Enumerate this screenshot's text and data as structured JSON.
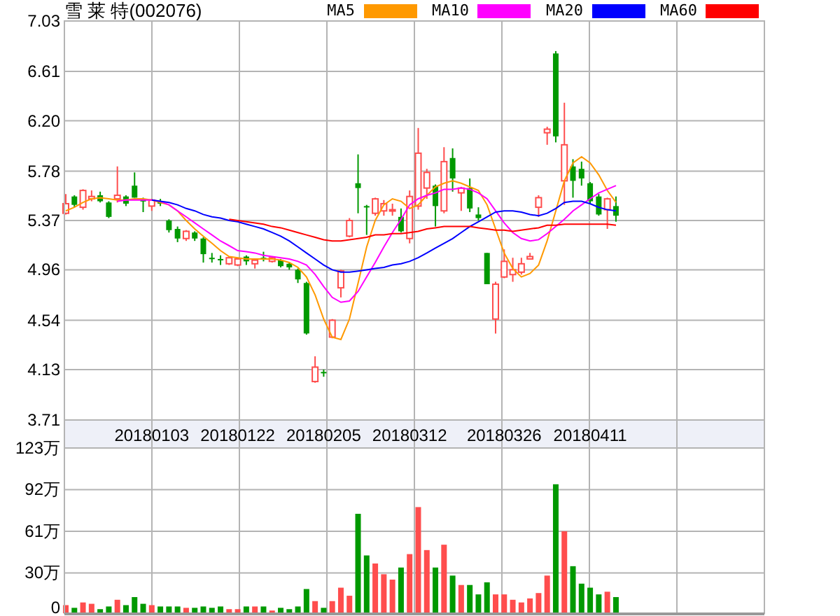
{
  "title": "雪 莱 特(002076)",
  "price": {
    "chart_data": {
      "type": "candlestick",
      "grid": true,
      "categories": [
        null,
        null,
        null,
        null,
        null,
        null,
        null,
        null,
        null,
        null,
        "20180103",
        null,
        null,
        null,
        null,
        null,
        null,
        null,
        null,
        null,
        "20180122",
        null,
        null,
        null,
        null,
        null,
        null,
        null,
        null,
        null,
        "20180205",
        null,
        null,
        null,
        null,
        null,
        null,
        null,
        null,
        null,
        "20180312",
        null,
        null,
        null,
        null,
        null,
        null,
        null,
        null,
        null,
        null,
        "20180326",
        null,
        null,
        null,
        null,
        null,
        null,
        null,
        null,
        null,
        "20180411",
        null,
        null,
        null
      ],
      "ylim": [
        3.71,
        7.03
      ],
      "yticks": [
        {
          "value": 7.03,
          "label": "7.03"
        },
        {
          "value": 6.61,
          "label": "6.61"
        },
        {
          "value": 6.2,
          "label": "6.20"
        },
        {
          "value": 5.78,
          "label": "5.78"
        },
        {
          "value": 5.37,
          "label": "5.37"
        },
        {
          "value": 4.96,
          "label": "4.96"
        },
        {
          "value": 4.54,
          "label": "4.54"
        },
        {
          "value": 4.13,
          "label": "4.13"
        },
        {
          "value": 3.71,
          "label": "3.71"
        }
      ],
      "series": [
        {
          "name": "MA5",
          "type": "line",
          "color": "#ff9900",
          "values": [
            5.45,
            5.48,
            5.52,
            5.55,
            5.56,
            5.55,
            5.54,
            5.54,
            5.55,
            5.55,
            5.54,
            5.52,
            5.5,
            5.45,
            5.37,
            5.3,
            5.24,
            5.18,
            5.12,
            5.07,
            5.06,
            5.05,
            5.05,
            5.05,
            5.05,
            5.04,
            5.02,
            4.98,
            4.9,
            4.75,
            4.55,
            4.4,
            4.38,
            4.55,
            4.85,
            5.15,
            5.37,
            5.5,
            5.55,
            5.53,
            5.47,
            5.5,
            5.58,
            5.65,
            5.68,
            5.7,
            5.68,
            5.65,
            5.62,
            5.5,
            5.3,
            5.1,
            4.97,
            4.9,
            4.93,
            5.0,
            5.2,
            5.45,
            5.7,
            5.85,
            5.9,
            5.85,
            5.75,
            5.62,
            5.52
          ]
        },
        {
          "name": "MA10",
          "type": "line",
          "color": "#ff00ff",
          "values": [
            null,
            null,
            null,
            null,
            null,
            null,
            5.53,
            5.54,
            5.54,
            5.54,
            5.54,
            5.53,
            5.5,
            5.45,
            5.4,
            5.35,
            5.3,
            5.25,
            5.2,
            5.16,
            5.12,
            5.11,
            5.1,
            5.08,
            5.07,
            5.06,
            5.05,
            5.03,
            5.0,
            4.92,
            4.82,
            4.73,
            4.69,
            4.7,
            4.78,
            4.9,
            5.02,
            5.15,
            5.27,
            5.38,
            5.5,
            5.55,
            5.58,
            5.6,
            5.63,
            5.63,
            5.64,
            5.63,
            5.6,
            5.55,
            5.45,
            5.35,
            5.27,
            5.22,
            5.2,
            5.21,
            5.26,
            5.32,
            5.38,
            5.45,
            5.5,
            5.55,
            5.6,
            5.63,
            5.66
          ]
        },
        {
          "name": "MA20",
          "type": "line",
          "color": "#0000ff",
          "values": [
            null,
            null,
            null,
            null,
            null,
            null,
            null,
            null,
            null,
            null,
            5.54,
            5.53,
            5.52,
            5.5,
            5.47,
            5.45,
            5.42,
            5.4,
            5.39,
            5.37,
            5.36,
            5.34,
            5.32,
            5.3,
            5.27,
            5.24,
            5.2,
            5.15,
            5.1,
            5.05,
            5.0,
            4.96,
            4.94,
            4.94,
            4.95,
            4.96,
            4.97,
            4.98,
            5.0,
            5.01,
            5.03,
            5.06,
            5.1,
            5.14,
            5.18,
            5.22,
            5.27,
            5.32,
            5.36,
            5.4,
            5.44,
            5.45,
            5.45,
            5.44,
            5.42,
            5.41,
            5.43,
            5.47,
            5.52,
            5.53,
            5.53,
            5.51,
            5.48,
            5.46,
            5.45
          ]
        },
        {
          "name": "MA60",
          "type": "line",
          "color": "#ff0000",
          "values": [
            null,
            null,
            null,
            null,
            null,
            null,
            null,
            null,
            null,
            null,
            null,
            null,
            null,
            null,
            null,
            null,
            null,
            null,
            null,
            5.38,
            5.37,
            5.36,
            5.35,
            5.34,
            5.32,
            5.31,
            5.29,
            5.27,
            5.25,
            5.23,
            5.21,
            5.2,
            5.2,
            5.21,
            5.22,
            5.23,
            5.25,
            5.25,
            5.26,
            5.26,
            5.27,
            5.28,
            5.3,
            5.31,
            5.32,
            5.32,
            5.32,
            5.32,
            5.31,
            5.3,
            5.29,
            5.29,
            5.28,
            5.29,
            5.3,
            5.31,
            5.33,
            5.33,
            5.34,
            5.34,
            5.34,
            5.34,
            5.34,
            5.34,
            5.33
          ]
        }
      ],
      "ohlc": [
        [
          5.43,
          5.59,
          5.42,
          5.51
        ],
        [
          5.57,
          5.58,
          5.48,
          5.5
        ],
        [
          5.48,
          5.63,
          5.46,
          5.62
        ],
        [
          5.55,
          5.62,
          5.53,
          5.57
        ],
        [
          5.58,
          5.61,
          5.52,
          5.53
        ],
        [
          5.52,
          5.53,
          5.39,
          5.4
        ],
        [
          5.55,
          5.82,
          5.52,
          5.58
        ],
        [
          5.57,
          5.58,
          5.49,
          5.51
        ],
        [
          5.66,
          5.77,
          5.56,
          5.56
        ],
        [
          5.54,
          5.56,
          5.44,
          5.53
        ],
        [
          5.49,
          5.55,
          5.45,
          5.54
        ],
        [
          5.53,
          5.55,
          5.49,
          5.51
        ],
        [
          5.37,
          5.38,
          5.27,
          5.29
        ],
        [
          5.3,
          5.32,
          5.19,
          5.22
        ],
        [
          5.22,
          5.29,
          5.2,
          5.28
        ],
        [
          5.27,
          5.28,
          5.2,
          5.22
        ],
        [
          5.22,
          5.23,
          5.02,
          5.09
        ],
        [
          5.06,
          5.1,
          5.02,
          5.05
        ],
        [
          5.05,
          5.08,
          5.0,
          5.04
        ],
        [
          5.01,
          5.07,
          5.0,
          5.06
        ],
        [
          5.0,
          5.06,
          4.99,
          5.05
        ],
        [
          5.07,
          5.08,
          5.0,
          5.03
        ],
        [
          5.01,
          5.05,
          4.97,
          5.04
        ],
        [
          5.06,
          5.11,
          5.03,
          5.05
        ],
        [
          5.03,
          5.07,
          5.02,
          5.06
        ],
        [
          5.04,
          5.05,
          4.98,
          4.99
        ],
        [
          5.01,
          5.02,
          4.96,
          4.98
        ],
        [
          4.96,
          4.97,
          4.85,
          4.88
        ],
        [
          4.85,
          4.86,
          4.42,
          4.43
        ],
        [
          4.03,
          4.24,
          4.02,
          4.15
        ],
        [
          4.11,
          4.13,
          4.07,
          4.1
        ],
        [
          4.4,
          4.55,
          4.39,
          4.54
        ],
        [
          4.81,
          4.96,
          4.73,
          4.95
        ],
        [
          5.24,
          5.39,
          5.23,
          5.37
        ],
        [
          5.68,
          5.92,
          5.43,
          5.64
        ],
        [
          5.49,
          5.5,
          5.25,
          5.48
        ],
        [
          5.43,
          5.56,
          5.41,
          5.55
        ],
        [
          5.45,
          5.54,
          5.41,
          5.51
        ],
        [
          5.45,
          5.51,
          5.41,
          5.46
        ],
        [
          5.4,
          5.47,
          5.27,
          5.28
        ],
        [
          5.22,
          5.62,
          5.18,
          5.57
        ],
        [
          5.49,
          6.14,
          5.46,
          5.93
        ],
        [
          5.64,
          5.8,
          5.55,
          5.77
        ],
        [
          5.66,
          5.67,
          5.32,
          5.49
        ],
        [
          5.45,
          5.98,
          5.43,
          5.86
        ],
        [
          5.89,
          5.97,
          5.61,
          5.72
        ],
        [
          5.6,
          5.65,
          5.45,
          5.64
        ],
        [
          5.64,
          5.72,
          5.44,
          5.47
        ],
        [
          5.42,
          5.48,
          5.37,
          5.39
        ],
        [
          5.1,
          5.1,
          4.84,
          4.84
        ],
        [
          4.55,
          4.86,
          4.43,
          4.84
        ],
        [
          4.9,
          5.13,
          4.89,
          5.03
        ],
        [
          4.92,
          5.06,
          4.86,
          4.96
        ],
        [
          4.94,
          5.06,
          4.92,
          5.01
        ],
        [
          5.05,
          5.1,
          5.05,
          5.07
        ],
        [
          5.48,
          5.58,
          5.4,
          5.56
        ],
        [
          6.1,
          6.15,
          6.0,
          6.13
        ],
        [
          6.76,
          6.78,
          6.02,
          6.07
        ],
        [
          5.7,
          6.35,
          5.5,
          6.0
        ],
        [
          5.82,
          5.88,
          5.56,
          5.7
        ],
        [
          5.8,
          5.86,
          5.66,
          5.72
        ],
        [
          5.68,
          5.69,
          5.51,
          5.53
        ],
        [
          5.57,
          5.59,
          5.41,
          5.42
        ],
        [
          5.46,
          5.56,
          5.3,
          5.55
        ],
        [
          5.49,
          5.57,
          5.36,
          5.41
        ]
      ]
    }
  },
  "volume": {
    "chart_data": {
      "type": "bar",
      "grid": true,
      "ylim": [
        0,
        123
      ],
      "yticks": [
        {
          "value": 123,
          "label": "123万"
        },
        {
          "value": 92,
          "label": "92万"
        },
        {
          "value": 61,
          "label": "61万"
        },
        {
          "value": 30,
          "label": "30万"
        },
        {
          "value": 0,
          "label": "0"
        }
      ],
      "values": [
        6,
        4,
        8,
        7,
        3,
        5,
        10,
        6,
        12,
        7,
        6,
        5,
        5,
        5,
        4,
        4,
        5,
        4,
        5,
        3,
        3,
        5,
        5,
        5,
        2,
        4,
        3,
        5,
        18,
        9,
        4,
        9,
        19,
        13,
        74,
        43,
        37,
        29,
        25,
        34,
        44,
        79,
        47,
        34,
        51,
        28,
        21,
        21,
        14,
        23,
        14,
        14,
        10,
        8,
        11,
        15,
        28,
        96,
        61,
        35,
        22,
        19,
        14,
        16,
        12
      ]
    }
  }
}
